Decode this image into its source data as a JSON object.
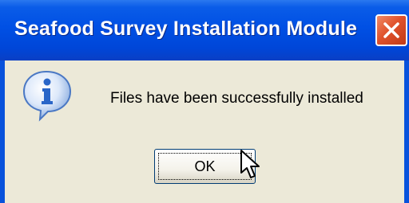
{
  "dialog": {
    "title": "Seafood Survey Installation Module",
    "message": "Files have been successfully installed",
    "ok_label": "OK"
  },
  "icons": {
    "close": "close-icon",
    "info": "info-icon",
    "cursor": "mouse-pointer-icon"
  },
  "colors": {
    "titlebar": "#0050e4",
    "close_button": "#e0522c",
    "dialog_background": "#ece9d8",
    "info_icon": "#2a66c8"
  }
}
